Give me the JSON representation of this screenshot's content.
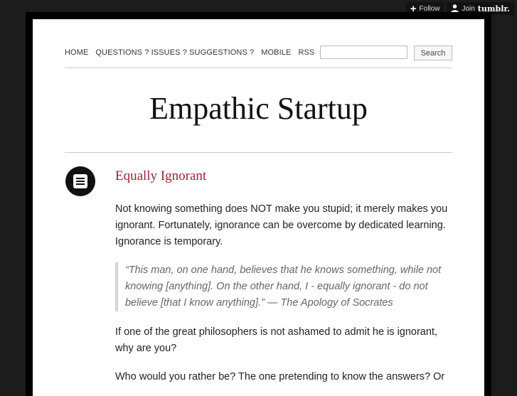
{
  "tumblr_bar": {
    "follow_label": "Follow",
    "join_label": "Join",
    "brand": "tumblr."
  },
  "nav": {
    "links": [
      "HOME",
      "QUESTIONS ? ISSUES ? SUGGESTIONS ?",
      "MOBILE",
      "RSS"
    ],
    "search_value": "",
    "search_button": "Search"
  },
  "site": {
    "title": "Empathic Startup"
  },
  "post": {
    "icon": "text-post-icon",
    "title": "Equally Ignorant",
    "paragraph1": "Not knowing something does NOT make you stupid; it merely makes you ignorant. Fortunately, ignorance can be overcome by dedicated learning. Ignorance is temporary.",
    "quote": "“This man, on one hand, believes that he knows something, while not knowing [anything]. On the other hand, I - equally ignorant - do not believe [that I know anything].” — The Apology of Socrates",
    "paragraph2": "If one of the great philosophers is not ashamed to admit he is ignorant, why are you?",
    "paragraph3": "Who would you rather be? The one pretending to know the answers? Or"
  },
  "colors": {
    "background": "#1c1c1c",
    "frame": "#000000",
    "post_title": "#9b2335"
  }
}
